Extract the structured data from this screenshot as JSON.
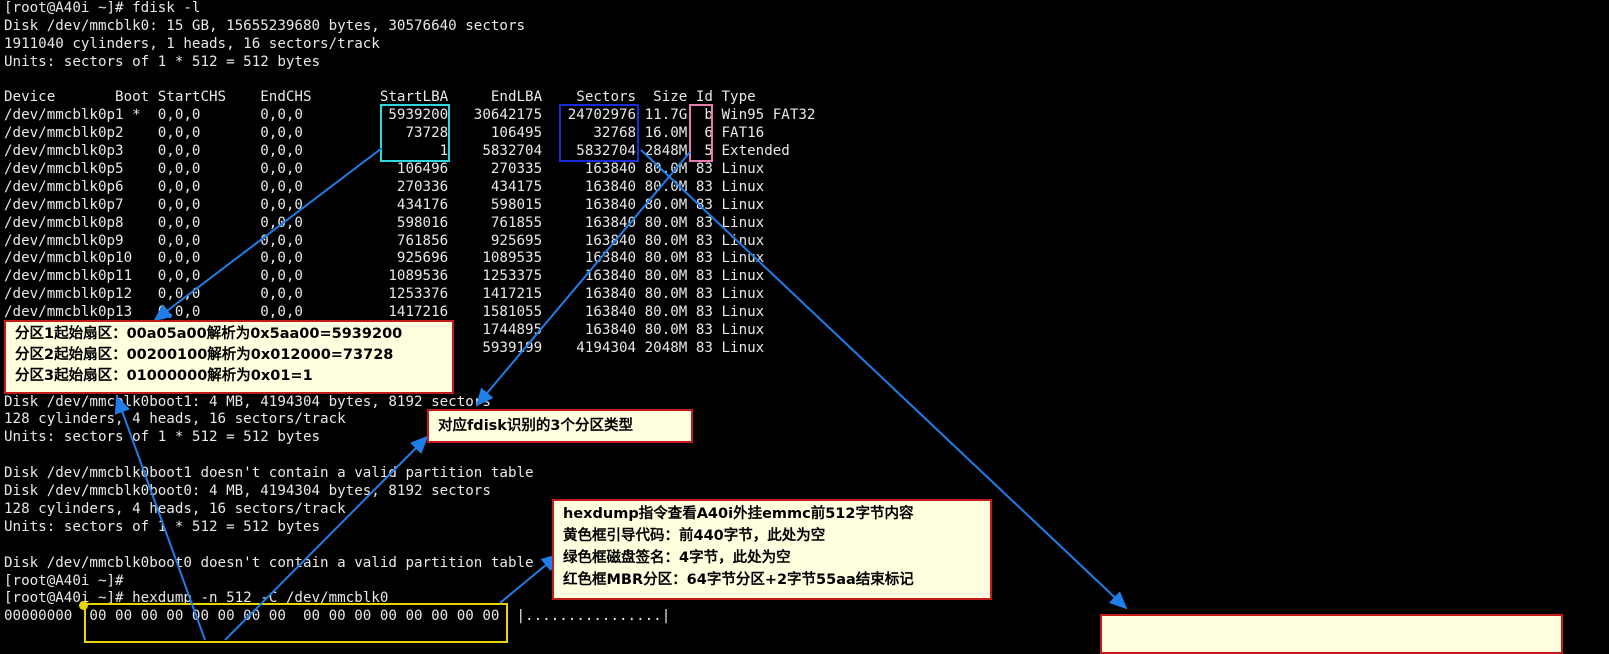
{
  "terminal": {
    "lines": [
      "[root@A40i ~]# fdisk -l",
      "Disk /dev/mmcblk0: 15 GB, 15655239680 bytes, 30576640 sectors",
      "1911040 cylinders, 1 heads, 16 sectors/track",
      "Units: sectors of 1 * 512 = 512 bytes",
      "",
      "Device       Boot StartCHS    EndCHS        StartLBA     EndLBA    Sectors  Size Id Type",
      "/dev/mmcblk0p1 *  0,0,0       0,0,0          5939200   30642175   24702976 11.7G  b Win95 FAT32",
      "/dev/mmcblk0p2    0,0,0       0,0,0            73728     106495      32768 16.0M  6 FAT16",
      "/dev/mmcblk0p3    0,0,0       0,0,0                1    5832704    5832704 2848M  5 Extended",
      "/dev/mmcblk0p5    0,0,0       0,0,0           106496     270335     163840 80.0M 83 Linux",
      "/dev/mmcblk0p6    0,0,0       0,0,0           270336     434175     163840 80.0M 83 Linux",
      "/dev/mmcblk0p7    0,0,0       0,0,0           434176     598015     163840 80.0M 83 Linux",
      "/dev/mmcblk0p8    0,0,0       0,0,0           598016     761855     163840 80.0M 83 Linux",
      "/dev/mmcblk0p9    0,0,0       0,0,0           761856     925695     163840 80.0M 83 Linux",
      "/dev/mmcblk0p10   0,0,0       0,0,0           925696    1089535     163840 80.0M 83 Linux",
      "/dev/mmcblk0p11   0,0,0       0,0,0          1089536    1253375     163840 80.0M 83 Linux",
      "/dev/mmcblk0p12   0,0,0       0,0,0          1253376    1417215     163840 80.0M 83 Linux",
      "/dev/mmcblk0p13   0,0,0       0,0,0          1417216    1581055     163840 80.0M 83 Linux",
      "                                                        1744895     163840 80.0M 83 Linux",
      "                                                        5939199    4194304 2048M 83 Linux",
      "",
      "",
      "Disk /dev/mmcblk0boot1: 4 MB, 4194304 bytes, 8192 sectors",
      "128 cylinders, 4 heads, 16 sectors/track",
      "Units: sectors of 1 * 512 = 512 bytes",
      "",
      "Disk /dev/mmcblk0boot1 doesn't contain a valid partition table",
      "Disk /dev/mmcblk0boot0: 4 MB, 4194304 bytes, 8192 sectors",
      "128 cylinders, 4 heads, 16 sectors/track",
      "Units: sectors of 1 * 512 = 512 bytes",
      "",
      "Disk /dev/mmcblk0boot0 doesn't contain a valid partition table",
      "[root@A40i ~]#",
      "[root@A40i ~]# hexdump -n 512 -C /dev/mmcblk0",
      "00000000  00 00 00 00 00 00 00 00  00 00 00 00 00 00 00 00  |................|"
    ]
  },
  "callouts": {
    "partition_start": {
      "lines": [
        "分区1起始扇区：00a05a00解析为0x5aa00=5939200",
        "分区2起始扇区：00200100解析为0x012000=73728",
        "分区3起始扇区：01000000解析为0x01=1"
      ]
    },
    "partition_types": {
      "text": "对应fdisk识别的3个分区类型"
    },
    "hexdump_info": {
      "lines": [
        "hexdump指令查看A40i外挂emmc前512字节内容",
        "黄色框引导代码：前440字节，此处为空",
        "绿色框磁盘签名：4字节，此处为空",
        "红色框MBR分区：64字节分区+2字节55aa结束标记"
      ]
    }
  },
  "colors": {
    "terminal_bg": "#000000",
    "terminal_fg": "#e8e8e8",
    "startlba_box": "#2fd8e0",
    "sectors_box": "#1a2bd8",
    "id_box": "#e87bb0",
    "hexdump_box": "#e8d400",
    "arrow": "#1f7ee8",
    "callout_bg": "#ffffe0",
    "callout_border": "#c41a1a"
  }
}
